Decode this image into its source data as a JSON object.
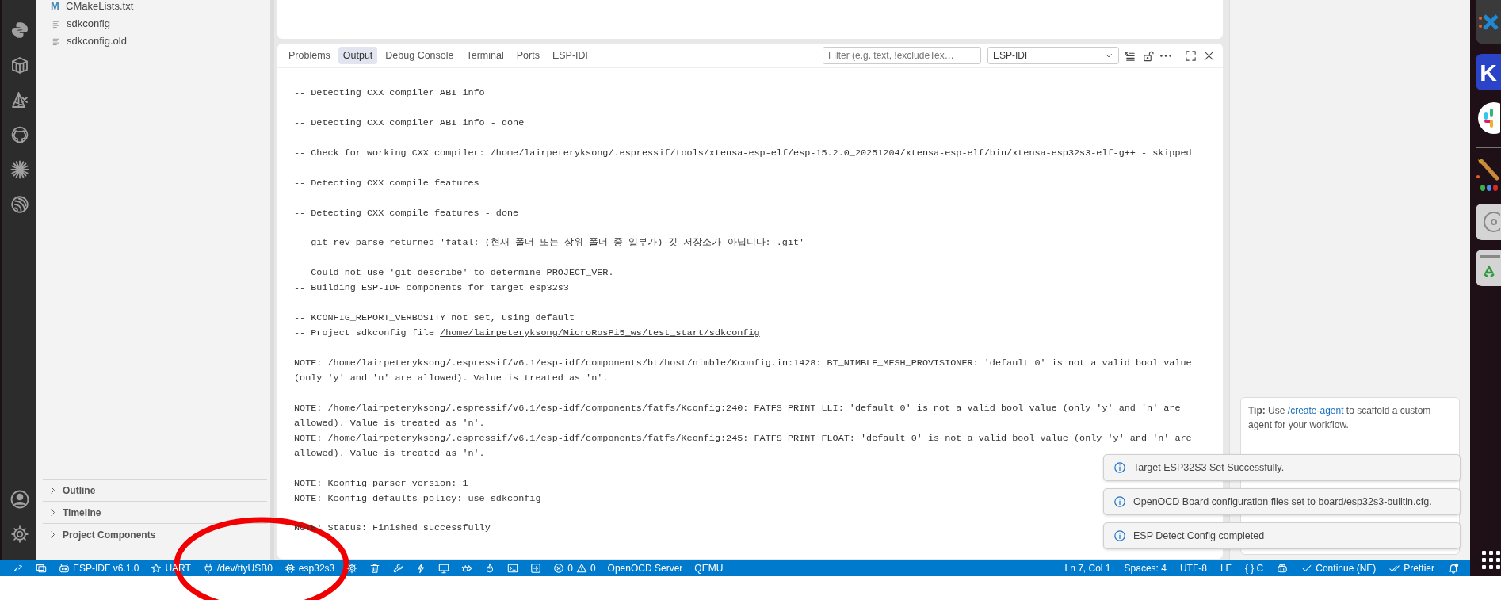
{
  "explorer": {
    "files": [
      {
        "name": "CMakeLists.txt",
        "kind": "glyph",
        "glyph": "M"
      },
      {
        "name": "sdkconfig",
        "kind": "lines"
      },
      {
        "name": "sdkconfig.old",
        "kind": "lines"
      }
    ]
  },
  "sidebar_sections": [
    {
      "label": "Outline",
      "expanded": false
    },
    {
      "label": "Timeline",
      "expanded": false
    },
    {
      "label": "Project Components",
      "expanded": false
    }
  ],
  "panel": {
    "tabs": [
      {
        "label": "Problems",
        "selected": false
      },
      {
        "label": "Output",
        "selected": true
      },
      {
        "label": "Debug Console",
        "selected": false
      },
      {
        "label": "Terminal",
        "selected": false
      },
      {
        "label": "Ports",
        "selected": false
      },
      {
        "label": "ESP-IDF",
        "selected": false
      }
    ],
    "filter": {
      "placeholder": "Filter (e.g. text, !excludeTex…"
    },
    "channel": {
      "value": "ESP-IDF"
    },
    "output": [
      [
        "-- Detecting CXX compiler ABI info"
      ],
      [
        "-- Detecting CXX compiler ABI info - done"
      ],
      [
        "-- Check for working CXX compiler: /home/lairpeteryksong/.espressif/tools/xtensa-esp-elf/esp-15.2.0_20251204/xtensa-esp-elf/bin/xtensa-esp32s3-elf-g++ - skipped"
      ],
      [
        "-- Detecting CXX compile features"
      ],
      [
        "-- Detecting CXX compile features - done"
      ],
      [
        "-- git rev-parse returned 'fatal: (현재 폴더 또는 상위 폴더 중 일부가) 깃 저장소가 아닙니다: .git'"
      ],
      [
        "-- Could not use 'git describe' to determine PROJECT_VER.",
        "-- Building ESP-IDF components for target esp32s3"
      ],
      [
        "-- KCONFIG_REPORT_VERBOSITY not set, using default",
        {
          "text": "-- Project sdkconfig file ",
          "link": "/home/lairpeteryksong/MicroRosPi5_ws/test_start/sdkconfig"
        }
      ],
      [
        "NOTE: /home/lairpeteryksong/.espressif/v6.1/esp-idf/components/bt/host/nimble/Kconfig.in:1428: BT_NIMBLE_MESH_PROVISIONER: 'default 0' is not a valid bool value",
        "(only 'y' and 'n' are allowed). Value is treated as 'n'."
      ],
      [
        "NOTE: /home/lairpeteryksong/.espressif/v6.1/esp-idf/components/fatfs/Kconfig:240: FATFS_PRINT_LLI: 'default 0' is not a valid bool value (only 'y' and 'n' are",
        "allowed). Value is treated as 'n'.",
        "NOTE: /home/lairpeteryksong/.espressif/v6.1/esp-idf/components/fatfs/Kconfig:245: FATFS_PRINT_FLOAT: 'default 0' is not a valid bool value (only 'y' and 'n' are",
        "allowed). Value is treated as 'n'."
      ],
      [
        "NOTE: Kconfig parser version: 1",
        "NOTE: Kconfig defaults policy: use sdkconfig"
      ],
      [
        "NOTE: Status: Finished successfully"
      ]
    ]
  },
  "tip": {
    "label": "Tip:",
    "before": " Use ",
    "link": "/create-agent",
    "after": " to scaffold a custom agent for your workflow."
  },
  "notifications": [
    {
      "message": "Target ESP32S3 Set Successfully."
    },
    {
      "message": "OpenOCD Board configuration files set to board/esp32s3-builtin.cfg."
    },
    {
      "message": "ESP Detect Config completed"
    }
  ],
  "status_bar": {
    "left": [
      {
        "kind": "remote"
      },
      {
        "kind": "folder"
      },
      {
        "kind": "robot",
        "text": "ESP-IDF v6.1.0"
      },
      {
        "kind": "star",
        "text": "UART"
      },
      {
        "kind": "plug",
        "text": "/dev/ttyUSB0"
      },
      {
        "kind": "chip",
        "text": "esp32s3"
      },
      {
        "kind": "gear"
      },
      {
        "kind": "trash"
      },
      {
        "kind": "wrench"
      },
      {
        "kind": "bolt"
      },
      {
        "kind": "monitor"
      },
      {
        "kind": "bug"
      },
      {
        "kind": "flame"
      },
      {
        "kind": "terminal"
      },
      {
        "kind": "signin"
      },
      {
        "kind": "problems",
        "errors": "0",
        "warnings": "0"
      },
      {
        "kind": "text",
        "text": "OpenOCD Server"
      },
      {
        "kind": "text",
        "text": "QEMU"
      }
    ],
    "right": [
      {
        "kind": "text",
        "text": "Ln 7, Col 1"
      },
      {
        "kind": "text",
        "text": "Spaces: 4"
      },
      {
        "kind": "text",
        "text": "UTF-8"
      },
      {
        "kind": "text",
        "text": "LF"
      },
      {
        "kind": "text",
        "text": "{ } C"
      },
      {
        "kind": "copilot"
      },
      {
        "kind": "check",
        "text": "Continue (NE)"
      },
      {
        "kind": "doublecheck",
        "text": "Prettier"
      },
      {
        "kind": "bell"
      }
    ]
  },
  "dock": [
    {
      "kind": "cross"
    },
    {
      "kind": "letter",
      "label": "K"
    },
    {
      "kind": "hash"
    },
    {
      "kind": "divider"
    },
    {
      "kind": "brush"
    },
    {
      "kind": "disc"
    },
    {
      "kind": "bin"
    },
    {
      "kind": "grid"
    }
  ],
  "annotations": [
    {
      "kind": "ellipse"
    }
  ]
}
